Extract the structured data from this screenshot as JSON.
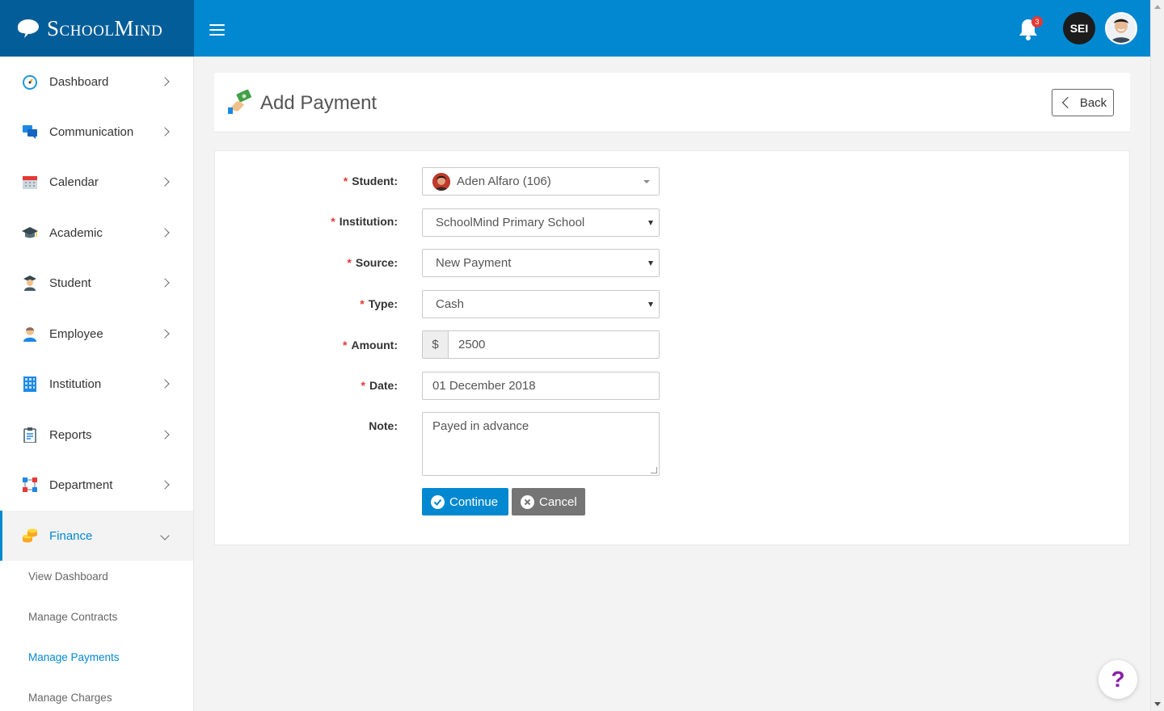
{
  "app": {
    "brand": "SchoolMind",
    "notification_count": "3",
    "user_initials": "SEI"
  },
  "sidebar": {
    "items": [
      {
        "label": "Dashboard",
        "icon": "dashboard-gauge-icon"
      },
      {
        "label": "Communication",
        "icon": "chat-bubbles-icon"
      },
      {
        "label": "Calendar",
        "icon": "calendar-icon"
      },
      {
        "label": "Academic",
        "icon": "graduation-cap-icon"
      },
      {
        "label": "Student",
        "icon": "student-icon"
      },
      {
        "label": "Employee",
        "icon": "employee-icon"
      },
      {
        "label": "Institution",
        "icon": "building-icon"
      },
      {
        "label": "Reports",
        "icon": "clipboard-icon"
      },
      {
        "label": "Department",
        "icon": "department-icon"
      },
      {
        "label": "Finance",
        "icon": "coins-icon"
      }
    ],
    "finance_sub": [
      {
        "label": "View Dashboard"
      },
      {
        "label": "Manage Contracts"
      },
      {
        "label": "Manage Payments"
      },
      {
        "label": "Manage Charges"
      }
    ]
  },
  "page": {
    "title": "Add Payment",
    "back_label": "Back"
  },
  "form": {
    "student_label": "Student:",
    "student_value": "Aden Alfaro (106)",
    "institution_label": "Institution:",
    "institution_value": "SchoolMind Primary School",
    "source_label": "Source:",
    "source_value": "New Payment",
    "type_label": "Type:",
    "type_value": "Cash",
    "amount_label": "Amount:",
    "amount_currency": "$",
    "amount_value": "2500",
    "date_label": "Date:",
    "date_value": "01 December 2018",
    "note_label": "Note:",
    "note_value": "Payed in advance",
    "required_mark": "*",
    "continue_label": "Continue",
    "cancel_label": "Cancel"
  },
  "help_label": "?",
  "colors": {
    "primary": "#0288d1",
    "brand_dark": "#035d98",
    "required": "#e53935",
    "cancel": "#757575",
    "help": "#8b1fa9"
  }
}
